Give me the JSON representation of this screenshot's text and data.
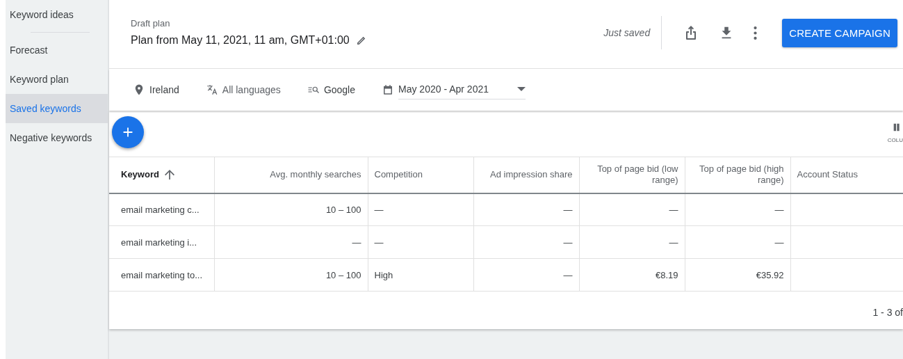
{
  "sidebar": {
    "groups": [
      {
        "items": [
          {
            "label": "Keyword ideas",
            "selected": false
          }
        ]
      },
      {
        "items": [
          {
            "label": "Forecast",
            "selected": false
          },
          {
            "label": "Keyword plan",
            "selected": false
          },
          {
            "label": "Saved keywords",
            "selected": true
          },
          {
            "label": "Negative keywords",
            "selected": false
          }
        ]
      }
    ]
  },
  "header": {
    "subtitle": "Draft plan",
    "title": "Plan from May 11, 2021, 11 am, GMT+01:00",
    "save_status": "Just saved",
    "primary_button": "CREATE CAMPAIGN"
  },
  "filters": {
    "location": "Ireland",
    "language": "All languages",
    "network": "Google",
    "date_range": "May 2020 - Apr 2021"
  },
  "toolbar": {
    "columns_label": "COLU"
  },
  "table": {
    "columns": [
      {
        "label": "Keyword",
        "kind": "text",
        "sorted": true
      },
      {
        "label": "Avg. monthly searches",
        "kind": "number",
        "sorted": false
      },
      {
        "label": "Competition",
        "kind": "text",
        "sorted": false
      },
      {
        "label": "Ad impression share",
        "kind": "number",
        "sorted": false
      },
      {
        "label": "Top of page bid (low range)",
        "kind": "number",
        "sorted": false
      },
      {
        "label": "Top of page bid (high range)",
        "kind": "number",
        "sorted": false
      },
      {
        "label": "Account Status",
        "kind": "text",
        "sorted": false
      }
    ],
    "rows": [
      [
        "email marketing c...",
        "10 – 100",
        "—",
        "—",
        "—",
        "—",
        ""
      ],
      [
        "email marketing i...",
        "—",
        "—",
        "—",
        "—",
        "—",
        ""
      ],
      [
        "email marketing to...",
        "10 – 100",
        "High",
        "—",
        "€8.19",
        "€35.92",
        ""
      ]
    ]
  },
  "pagination": "1 - 3 of"
}
